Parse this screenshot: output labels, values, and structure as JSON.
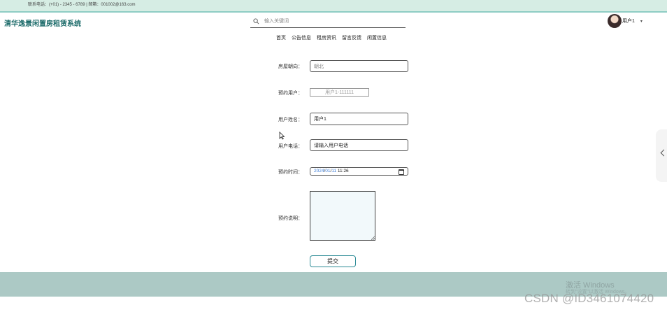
{
  "topbar": {
    "contact_text": "联系电话：(+01) - 2345 - 6789 | 邮箱：001002@163.com"
  },
  "header": {
    "site_title": "清华逸景闲置房租赁系统",
    "search": {
      "placeholder": "输入关键词",
      "value": ""
    },
    "user": {
      "name": "用户1",
      "caret": "▾"
    }
  },
  "nav": {
    "items": [
      {
        "label": "首页"
      },
      {
        "label": "公告信息"
      },
      {
        "label": "租房资讯"
      },
      {
        "label": "留言反馈"
      },
      {
        "label": "闲置信息"
      }
    ]
  },
  "form": {
    "house_orientation": {
      "label": "房屋朝向：",
      "value": "朝北"
    },
    "booking_user": {
      "label": "预约用户：",
      "value": "用户1-111111"
    },
    "user_name": {
      "label": "用户姓名：",
      "value": "用户1"
    },
    "user_phone": {
      "label": "用户电话：",
      "value": "请输入用户电话"
    },
    "booking_time": {
      "label": "预约时间：",
      "year": "2024",
      "month": "01",
      "day": "11",
      "time": "11:26"
    },
    "booking_note": {
      "label": "预约说明：",
      "value": ""
    },
    "submit_label": "提交"
  },
  "watermarks": {
    "windows_title": "激活 Windows",
    "windows_sub": "转到\"设置\"以激活 Windows。",
    "csdn": "CSDN @ID3461074420"
  },
  "colors": {
    "topbar_bg": "#d6ede4",
    "title_color": "#1c6b6a",
    "footer_bg": "#acc9c5",
    "button_border": "#2a8a95"
  }
}
